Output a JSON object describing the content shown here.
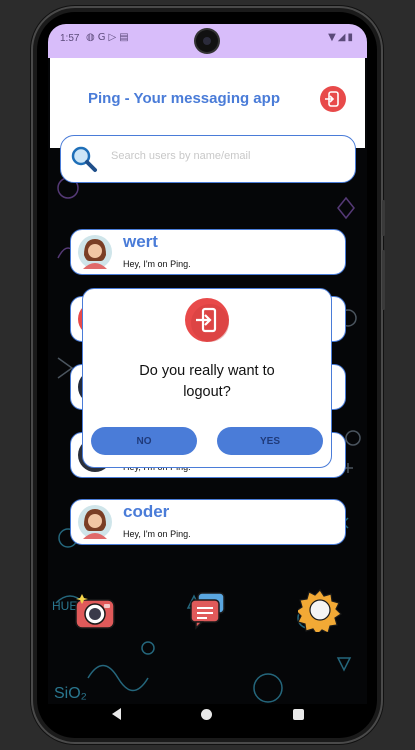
{
  "status_bar": {
    "time": "1:57",
    "left_icons": [
      "privacy-icon",
      "google-icon",
      "play-icon",
      "sim-icon"
    ],
    "right_icons": [
      "wifi-icon",
      "signal-icon",
      "battery-icon"
    ]
  },
  "header": {
    "title": "Ping - Your messaging app",
    "logout_icon": "logout-icon"
  },
  "search": {
    "placeholder": "Search users by name/email",
    "value": ""
  },
  "users": [
    {
      "name": "wert",
      "status": "Hey, I'm on Ping."
    },
    {
      "name": "",
      "status": ""
    },
    {
      "name": "",
      "status": ""
    },
    {
      "name": "",
      "status": "Hey, I'm on Ping."
    },
    {
      "name": "coder",
      "status": "Hey, I'm on Ping."
    }
  ],
  "dialog": {
    "icon": "logout-icon",
    "message_line1": "Do you really want to",
    "message_line2": "logout?",
    "no_label": "NO",
    "yes_label": "YES"
  },
  "bottom_nav": {
    "items": [
      "camera-icon",
      "chat-icon",
      "settings-icon"
    ]
  },
  "colors": {
    "accent": "#4a7cd8",
    "status_bar": "#d8bdfa",
    "logout_red": "#e84a4a"
  }
}
